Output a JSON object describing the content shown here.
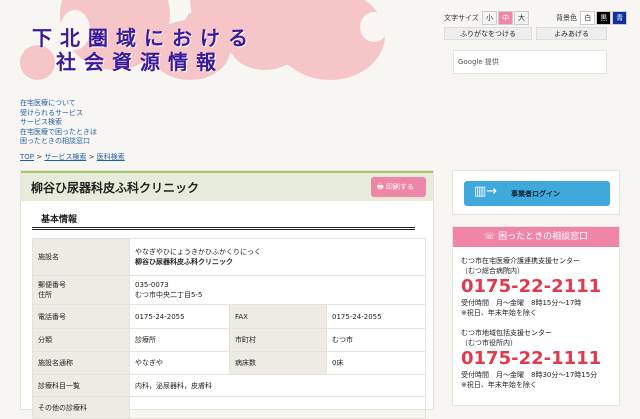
{
  "header": {
    "logo_line1": "下北圏域における",
    "logo_line2": "社会資源情報",
    "font_size_label": "文字サイズ",
    "font_sizes": [
      "小",
      "中",
      "大"
    ],
    "bg_color_label": "背景色",
    "bg_colors": [
      "白",
      "黒",
      "青"
    ],
    "furigana_button": "ふりがなをつける",
    "read_aloud_button": "よみあげる",
    "search_placeholder": "Google 提供"
  },
  "nav": [
    "在宅医療について",
    "受けられるサービス",
    "サービス検索",
    "在宅医療で困ったときは",
    "困ったときの相談窓口"
  ],
  "breadcrumb": [
    "TOP",
    "サービス検索",
    "医科検索"
  ],
  "main": {
    "title": "柳谷ひ尿器科皮ふ科クリニック",
    "print_button": "印刷する",
    "section": "基本情報",
    "rows": {
      "name_label": "施設名",
      "name_kana": "やなぎやひにょうきかひふかくりにっく",
      "name": "柳谷ひ尿器科皮ふ科クリニック",
      "postal_label": "郵便番号",
      "address_label": "住所",
      "postal": "035-0073",
      "address": "むつ市中央二丁目5-5",
      "tel_label": "電話番号",
      "tel": "0175-24-2055",
      "fax_label": "FAX",
      "fax": "0175-24-2055",
      "category_label": "分類",
      "category": "診療所",
      "city_label": "市町村",
      "city": "むつ市",
      "alias_label": "施設名通称",
      "alias": "やなぎや",
      "beds_label": "病床数",
      "beds": "0床",
      "depts_label": "診療科目一覧",
      "depts": "内科，泌尿器科，皮膚科",
      "other_label": "その他の診療科"
    }
  },
  "side": {
    "login": "事業者ログイン",
    "consult_title": "困ったときの相談窓口",
    "c1": {
      "name": "むつ市在宅医療介護連携支援センター",
      "sub": "（むつ総合病院内）",
      "phone": "0175-22-2111",
      "hours": "受付時間　月～金曜　8時15分～17時",
      "note": "※祝日、年末年始を除く"
    },
    "c2": {
      "name": "むつ市地域包括支援センター",
      "sub": "（むつ市役所内）",
      "phone": "0175-22-1111",
      "hours": "受付時間　月～金曜　8時30分～17時15分",
      "note": "※祝日、年末年始を除く"
    }
  },
  "colors": {
    "accent": "#ef86a8",
    "login": "#3fa9dc",
    "phone": "#e03a4e",
    "logo": "#3a1a9a"
  }
}
